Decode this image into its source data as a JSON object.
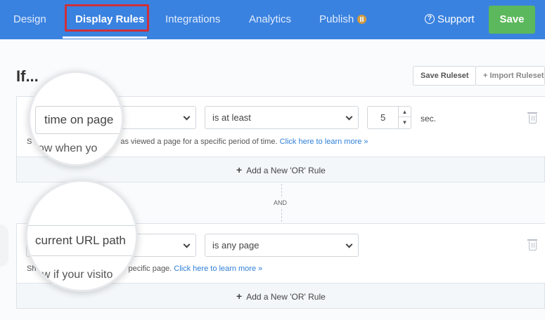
{
  "nav": {
    "items": [
      "Design",
      "Display Rules",
      "Integrations",
      "Analytics",
      "Publish"
    ],
    "active": "Display Rules",
    "support_label": "Support",
    "save_label": "Save"
  },
  "page": {
    "heading": "If...",
    "save_ruleset": "Save Ruleset",
    "import_ruleset": "+ Import Ruleset",
    "and_label": "AND"
  },
  "rules": [
    {
      "field": "time on page",
      "operator": "is at least",
      "value": "5",
      "unit": "sec.",
      "help_prefix": "S",
      "help_text": "as viewed a page for a specific period of time. ",
      "help_link": "Click here to learn more »",
      "magnified_hint": "how when yo",
      "add_or": "Add a New 'OR' Rule"
    },
    {
      "field": "current URL path",
      "operator": "is any page",
      "help_prefix": "Sh",
      "help_text": "pecific page. ",
      "help_link": "Click here to learn more »",
      "magnified_hint": "ow if your visito",
      "add_or": "Add a New 'OR' Rule"
    }
  ],
  "colors": {
    "nav_bg": "#3a82e0",
    "save_green": "#5cb85c",
    "highlight_red": "#d0303a",
    "link_blue": "#2f7fd8",
    "badge_orange": "#f0a020"
  }
}
